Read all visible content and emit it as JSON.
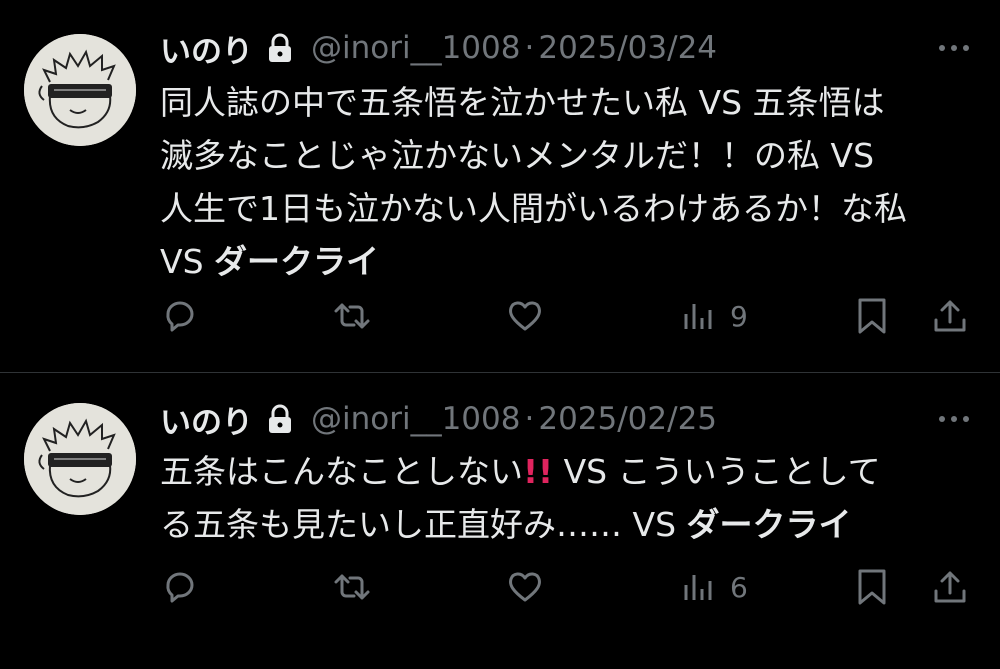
{
  "colors": {
    "background": "#000000",
    "text": "#e7e9ea",
    "muted": "#71767b",
    "divider": "#2f3336",
    "avatar_bg": "#e4e3dc",
    "emoji_red": "#e0245e"
  },
  "icons": {
    "lock": "lock-icon",
    "more": "more-icon",
    "reply": "reply-icon",
    "retweet": "retweet-icon",
    "like": "heart-icon",
    "views": "views-icon",
    "bookmark": "bookmark-icon",
    "share": "share-icon"
  },
  "tweets": [
    {
      "name": "いのり",
      "handle": "@inori__1008",
      "separator": "·",
      "date": "2025/03/24",
      "lines": [
        [
          {
            "text": "同人誌の中で五条悟を泣かせたい私 VS 五条悟は"
          }
        ],
        [
          {
            "text": "滅多なことじゃ泣かないメンタルだ！！の私 VS"
          }
        ],
        [
          {
            "text": "人生で1日も泣かない人間がいるわけあるか！な私"
          }
        ],
        [
          {
            "text": "VS "
          },
          {
            "text": "ダークライ",
            "bold": true
          }
        ]
      ],
      "views": "9"
    },
    {
      "name": "いのり",
      "handle": "@inori__1008",
      "separator": "·",
      "date": "2025/02/25",
      "lines": [
        [
          {
            "text": "五条はこんなことしない"
          },
          {
            "text": "!!",
            "emoji": true
          },
          {
            "text": " VS こういうことして"
          }
        ],
        [
          {
            "text": "る五条も見たいし正直好み…… VS "
          },
          {
            "text": "ダークライ",
            "bold": true
          }
        ]
      ],
      "views": "6"
    }
  ]
}
